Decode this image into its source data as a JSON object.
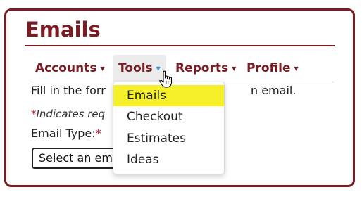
{
  "page": {
    "title": "Emails"
  },
  "nav": {
    "items": [
      {
        "label": "Accounts"
      },
      {
        "label": "Tools"
      },
      {
        "label": "Reports"
      },
      {
        "label": "Profile"
      }
    ],
    "caret_glyph": "▼"
  },
  "tools_menu": {
    "items": [
      {
        "label": "Emails",
        "highlighted": true
      },
      {
        "label": "Checkout"
      },
      {
        "label": "Estimates"
      },
      {
        "label": "Ideas"
      }
    ]
  },
  "form": {
    "intro_left": "Fill in the forr",
    "intro_right": "n email.",
    "required_star": "*",
    "required_text": "Indicates req",
    "email_type_label": "Email Type:",
    "email_type_star": "*",
    "select_value": "Select an em"
  },
  "colors": {
    "brand": "#7b1b23",
    "highlight": "#f5f02a",
    "required": "#c0141d",
    "caret_active": "#3a8fd6"
  },
  "icons": {
    "cursor": "hand-pointer-icon"
  }
}
